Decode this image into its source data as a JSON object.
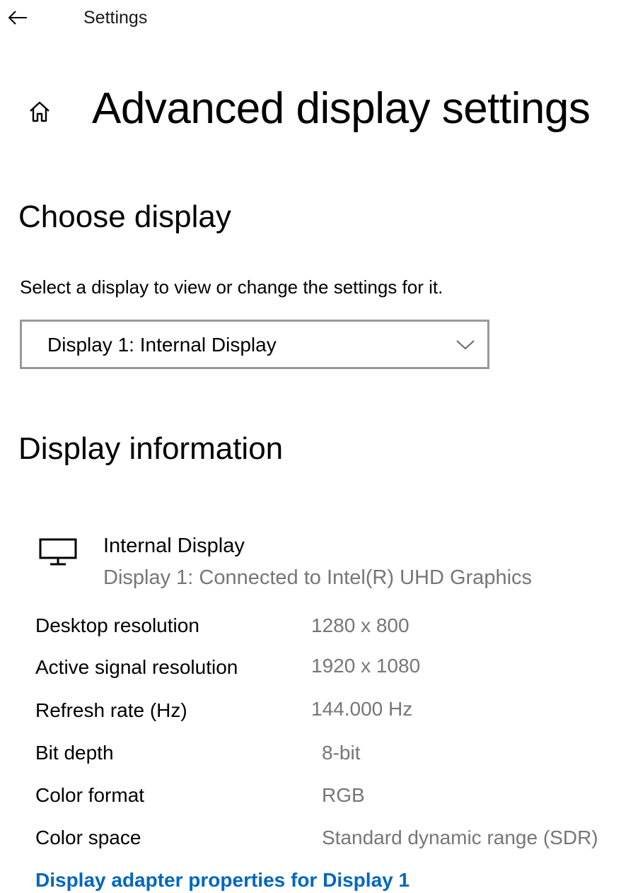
{
  "titlebar": {
    "back_icon": "arrow-left-icon",
    "app_title": "Settings"
  },
  "header": {
    "home_icon": "home-icon",
    "page_title": "Advanced display settings"
  },
  "choose_display": {
    "heading": "Choose display",
    "description": "Select a display to view or change the settings for it.",
    "selected": "Display 1: Internal Display",
    "dropdown_icon": "chevron-down-icon"
  },
  "display_info": {
    "heading": "Display information",
    "monitor_icon": "monitor-icon",
    "display_name": "Internal Display",
    "display_connection": "Display 1: Connected to Intel(R) UHD Graphics",
    "rows": [
      {
        "label": "Desktop resolution",
        "value": "1280 x 800"
      },
      {
        "label": "Active signal resolution",
        "value": "1920 x 1080"
      },
      {
        "label": "Refresh rate (Hz)",
        "value": "144.000 Hz"
      },
      {
        "label": "Bit depth",
        "value": "8-bit"
      },
      {
        "label": "Color format",
        "value": "RGB"
      },
      {
        "label": "Color space",
        "value": "Standard dynamic range (SDR)"
      }
    ],
    "adapter_link": "Display adapter properties for Display 1"
  },
  "colors": {
    "accent_link": "#0067c0",
    "secondary_text": "#767676",
    "dropdown_border": "#999999"
  }
}
